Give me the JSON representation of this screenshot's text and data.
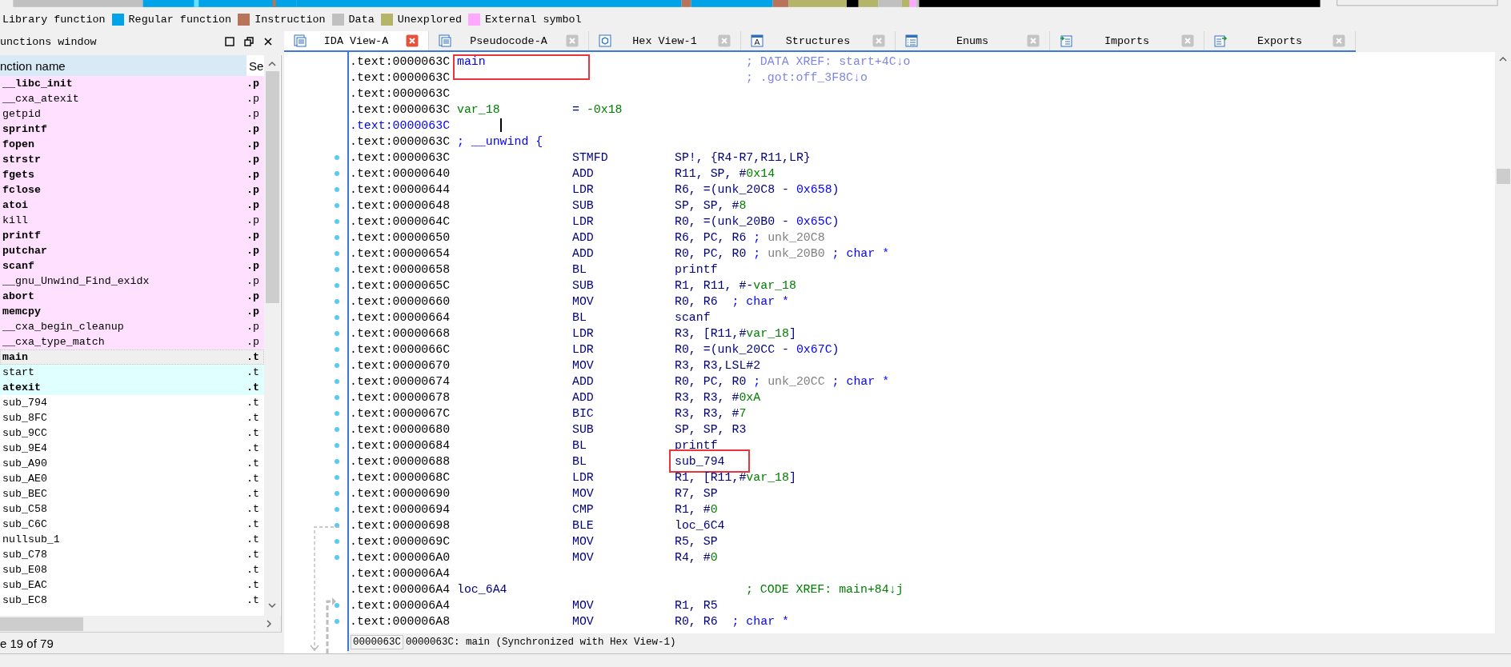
{
  "legend": [
    {
      "label": "Library function"
    },
    {
      "label": "Regular function",
      "color": "#00a2e8"
    },
    {
      "label": "Instruction",
      "color": "#b8735a"
    },
    {
      "label": "Data",
      "color": "#c0c0c0"
    },
    {
      "label": "Unexplored",
      "color": "#b5b56a"
    },
    {
      "label": "External symbol",
      "color": "#ffa8ff"
    }
  ],
  "functions_window": {
    "title": "unctions window",
    "columns": [
      "nction name",
      "Se"
    ],
    "rows": [
      {
        "name": "__libc_init",
        "column_2": ".p",
        "bold": true,
        "color": "#ffe1ff",
        "selected": false
      },
      {
        "name": "__cxa_atexit",
        "column_2": ".p",
        "bold": false,
        "color": "#ffe1ff",
        "selected": false
      },
      {
        "name": "getpid",
        "column_2": ".p",
        "bold": false,
        "color": "#ffe1ff",
        "selected": false
      },
      {
        "name": "sprintf",
        "column_2": ".p",
        "bold": true,
        "color": "#ffe1ff",
        "selected": false
      },
      {
        "name": "fopen",
        "column_2": ".p",
        "bold": true,
        "color": "#ffe1ff",
        "selected": false
      },
      {
        "name": "strstr",
        "column_2": ".p",
        "bold": true,
        "color": "#ffe1ff",
        "selected": false
      },
      {
        "name": "fgets",
        "column_2": ".p",
        "bold": true,
        "color": "#ffe1ff",
        "selected": false
      },
      {
        "name": "fclose",
        "column_2": ".p",
        "bold": true,
        "color": "#ffe1ff",
        "selected": false
      },
      {
        "name": "atoi",
        "column_2": ".p",
        "bold": true,
        "color": "#ffe1ff",
        "selected": false
      },
      {
        "name": "kill",
        "column_2": ".p",
        "bold": false,
        "color": "#ffe1ff",
        "selected": false
      },
      {
        "name": "printf",
        "column_2": ".p",
        "bold": true,
        "color": "#ffe1ff",
        "selected": false
      },
      {
        "name": "putchar",
        "column_2": ".p",
        "bold": true,
        "color": "#ffe1ff",
        "selected": false
      },
      {
        "name": "scanf",
        "column_2": ".p",
        "bold": true,
        "color": "#ffe1ff",
        "selected": false
      },
      {
        "name": "__gnu_Unwind_Find_exidx",
        "column_2": ".p",
        "bold": false,
        "color": "#ffe1ff",
        "selected": false
      },
      {
        "name": "abort",
        "column_2": ".p",
        "bold": true,
        "color": "#ffe1ff",
        "selected": false
      },
      {
        "name": "memcpy",
        "column_2": ".p",
        "bold": true,
        "color": "#ffe1ff",
        "selected": false
      },
      {
        "name": "__cxa_begin_cleanup",
        "column_2": ".p",
        "bold": false,
        "color": "#ffe1ff",
        "selected": false
      },
      {
        "name": "__cxa_type_match",
        "column_2": ".p",
        "bold": false,
        "color": "#ffe1ff",
        "selected": false
      },
      {
        "name": "main",
        "column_2": ".t",
        "bold": true,
        "color": "#efefef",
        "selected": true
      },
      {
        "name": "start",
        "column_2": ".t",
        "bold": false,
        "color": "#e0ffff",
        "selected": false
      },
      {
        "name": "atexit",
        "column_2": ".t",
        "bold": true,
        "color": "#e0ffff",
        "selected": false
      },
      {
        "name": "sub_794",
        "column_2": ".t",
        "bold": false,
        "color": "#ffffff",
        "selected": false
      },
      {
        "name": "sub_8FC",
        "column_2": ".t",
        "bold": false,
        "color": "#ffffff",
        "selected": false
      },
      {
        "name": "sub_9CC",
        "column_2": ".t",
        "bold": false,
        "color": "#ffffff",
        "selected": false
      },
      {
        "name": "sub_9E4",
        "column_2": ".t",
        "bold": false,
        "color": "#ffffff",
        "selected": false
      },
      {
        "name": "sub_A90",
        "column_2": ".t",
        "bold": false,
        "color": "#ffffff",
        "selected": false
      },
      {
        "name": "sub_AE0",
        "column_2": ".t",
        "bold": false,
        "color": "#ffffff",
        "selected": false
      },
      {
        "name": "sub_BEC",
        "column_2": ".t",
        "bold": false,
        "color": "#ffffff",
        "selected": false
      },
      {
        "name": "sub_C58",
        "column_2": ".t",
        "bold": false,
        "color": "#ffffff",
        "selected": false
      },
      {
        "name": "sub_C6C",
        "column_2": ".t",
        "bold": false,
        "color": "#ffffff",
        "selected": false
      },
      {
        "name": "nullsub_1",
        "column_2": ".t",
        "bold": false,
        "color": "#ffffff",
        "selected": false
      },
      {
        "name": "sub_C78",
        "column_2": ".t",
        "bold": false,
        "color": "#ffffff",
        "selected": false
      },
      {
        "name": "sub_E08",
        "column_2": ".t",
        "bold": false,
        "color": "#ffffff",
        "selected": false
      },
      {
        "name": "sub_EAC",
        "column_2": ".t",
        "bold": false,
        "color": "#ffffff",
        "selected": false
      },
      {
        "name": "sub_EC8",
        "column_2": ".t",
        "bold": false,
        "color": "#ffffff",
        "selected": false
      }
    ],
    "status": "e 19 of 79"
  },
  "tabs": [
    {
      "label": "IDA View-A",
      "kind": "disasm",
      "selected": true
    },
    {
      "label": "Pseudocode-A",
      "kind": "pseudocode",
      "selected": false
    },
    {
      "label": "Hex View-1",
      "kind": "hex",
      "selected": false
    },
    {
      "label": "Structures",
      "kind": "structures",
      "selected": false
    },
    {
      "label": "Enums",
      "kind": "enums",
      "selected": false
    },
    {
      "label": "Imports",
      "kind": "imports",
      "selected": false
    },
    {
      "label": "Exports",
      "kind": "exports",
      "selected": false
    }
  ],
  "disassembly": {
    "lines": [
      {
        "address": ".text:0000063C",
        "selected": false,
        "dot": false,
        "label": [
          {
            "text": "main",
            "kind": "name",
            "boxed": true
          }
        ],
        "comment": [
          {
            "text": "; DATA XREF: start+4C↓o",
            "kind": "xref"
          }
        ]
      },
      {
        "address": ".text:0000063C",
        "selected": false,
        "dot": false,
        "comment": [
          {
            "text": "; .got:off_3F8C↓o",
            "kind": "xref"
          }
        ]
      },
      {
        "address": ".text:0000063C",
        "selected": false,
        "dot": false
      },
      {
        "address": ".text:0000063C",
        "selected": false,
        "dot": false,
        "label": [
          {
            "text": "var_18",
            "kind": "var"
          }
        ],
        "mnemonic": [
          {
            "text": "= ",
            "kind": "code"
          },
          {
            "text": "-0x18",
            "kind": "num"
          }
        ]
      },
      {
        "address": ".text:0000063C",
        "selected": true,
        "dot": false
      },
      {
        "address": ".text:0000063C",
        "selected": false,
        "dot": false,
        "label": [
          {
            "text": "; __unwind {",
            "kind": "cmt"
          }
        ]
      },
      {
        "address": ".text:0000063C",
        "selected": false,
        "dot": true,
        "mnemonic": [
          {
            "text": "STMFD",
            "kind": "code"
          }
        ],
        "operands": [
          {
            "text": "SP!, {R4-R7,R11,LR}",
            "kind": "code"
          }
        ]
      },
      {
        "address": ".text:00000640",
        "selected": false,
        "dot": true,
        "mnemonic": [
          {
            "text": "ADD",
            "kind": "code"
          }
        ],
        "operands": [
          {
            "text": "R11, SP, #",
            "kind": "code"
          },
          {
            "text": "0x14",
            "kind": "num"
          }
        ]
      },
      {
        "address": ".text:00000644",
        "selected": false,
        "dot": true,
        "mnemonic": [
          {
            "text": "LDR",
            "kind": "code"
          }
        ],
        "operands": [
          {
            "text": "R6, =(unk_20C8 - ",
            "kind": "code"
          },
          {
            "text": "0x658",
            "kind": "addr"
          },
          {
            "text": ")",
            "kind": "code"
          }
        ]
      },
      {
        "address": ".text:00000648",
        "selected": false,
        "dot": true,
        "mnemonic": [
          {
            "text": "SUB",
            "kind": "code"
          }
        ],
        "operands": [
          {
            "text": "SP, SP, #",
            "kind": "code"
          },
          {
            "text": "8",
            "kind": "num"
          }
        ]
      },
      {
        "address": ".text:0000064C",
        "selected": false,
        "dot": true,
        "mnemonic": [
          {
            "text": "LDR",
            "kind": "code"
          }
        ],
        "operands": [
          {
            "text": "R0, =(unk_20B0 - ",
            "kind": "code"
          },
          {
            "text": "0x65C",
            "kind": "addr"
          },
          {
            "text": ")",
            "kind": "code"
          }
        ]
      },
      {
        "address": ".text:00000650",
        "selected": false,
        "dot": true,
        "mnemonic": [
          {
            "text": "ADD",
            "kind": "code"
          }
        ],
        "operands": [
          {
            "text": "R6, PC, R6 ",
            "kind": "code"
          },
          {
            "text": "; ",
            "kind": "cmt"
          },
          {
            "text": "unk_20C8",
            "kind": "auto"
          }
        ]
      },
      {
        "address": ".text:00000654",
        "selected": false,
        "dot": true,
        "mnemonic": [
          {
            "text": "ADD",
            "kind": "code"
          }
        ],
        "operands": [
          {
            "text": "R0, PC, R0 ",
            "kind": "code"
          },
          {
            "text": "; ",
            "kind": "cmt"
          },
          {
            "text": "unk_20B0",
            "kind": "auto"
          },
          {
            "text": " ; char *",
            "kind": "cmt"
          }
        ]
      },
      {
        "address": ".text:00000658",
        "selected": false,
        "dot": true,
        "mnemonic": [
          {
            "text": "BL",
            "kind": "code"
          }
        ],
        "operands": [
          {
            "text": "printf",
            "kind": "code"
          }
        ]
      },
      {
        "address": ".text:0000065C",
        "selected": false,
        "dot": true,
        "mnemonic": [
          {
            "text": "SUB",
            "kind": "code"
          }
        ],
        "operands": [
          {
            "text": "R1, R11, #-",
            "kind": "code"
          },
          {
            "text": "var_18",
            "kind": "var"
          }
        ]
      },
      {
        "address": ".text:00000660",
        "selected": false,
        "dot": true,
        "mnemonic": [
          {
            "text": "MOV",
            "kind": "code"
          }
        ],
        "operands": [
          {
            "text": "R0, R6  ",
            "kind": "code"
          },
          {
            "text": "; char *",
            "kind": "cmt"
          }
        ]
      },
      {
        "address": ".text:00000664",
        "selected": false,
        "dot": true,
        "mnemonic": [
          {
            "text": "BL",
            "kind": "code"
          }
        ],
        "operands": [
          {
            "text": "scanf",
            "kind": "code"
          }
        ]
      },
      {
        "address": ".text:00000668",
        "selected": false,
        "dot": true,
        "mnemonic": [
          {
            "text": "LDR",
            "kind": "code"
          }
        ],
        "operands": [
          {
            "text": "R3, [R11,#",
            "kind": "code"
          },
          {
            "text": "var_18",
            "kind": "var"
          },
          {
            "text": "]",
            "kind": "code"
          }
        ]
      },
      {
        "address": ".text:0000066C",
        "selected": false,
        "dot": true,
        "mnemonic": [
          {
            "text": "LDR",
            "kind": "code"
          }
        ],
        "operands": [
          {
            "text": "R0, =(unk_20CC - ",
            "kind": "code"
          },
          {
            "text": "0x67C",
            "kind": "addr"
          },
          {
            "text": ")",
            "kind": "code"
          }
        ]
      },
      {
        "address": ".text:00000670",
        "selected": false,
        "dot": true,
        "mnemonic": [
          {
            "text": "MOV",
            "kind": "code"
          }
        ],
        "operands": [
          {
            "text": "R3, R3,LSL#2",
            "kind": "code"
          }
        ]
      },
      {
        "address": ".text:00000674",
        "selected": false,
        "dot": true,
        "mnemonic": [
          {
            "text": "ADD",
            "kind": "code"
          }
        ],
        "operands": [
          {
            "text": "R0, PC, R0 ",
            "kind": "code"
          },
          {
            "text": "; ",
            "kind": "cmt"
          },
          {
            "text": "unk_20CC",
            "kind": "auto"
          },
          {
            "text": " ; char *",
            "kind": "cmt"
          }
        ]
      },
      {
        "address": ".text:00000678",
        "selected": false,
        "dot": true,
        "mnemonic": [
          {
            "text": "ADD",
            "kind": "code"
          }
        ],
        "operands": [
          {
            "text": "R3, R3, #",
            "kind": "code"
          },
          {
            "text": "0xA",
            "kind": "num"
          }
        ]
      },
      {
        "address": ".text:0000067C",
        "selected": false,
        "dot": true,
        "mnemonic": [
          {
            "text": "BIC",
            "kind": "code"
          }
        ],
        "operands": [
          {
            "text": "R3, R3, #",
            "kind": "code"
          },
          {
            "text": "7",
            "kind": "num"
          }
        ]
      },
      {
        "address": ".text:00000680",
        "selected": false,
        "dot": true,
        "mnemonic": [
          {
            "text": "SUB",
            "kind": "code"
          }
        ],
        "operands": [
          {
            "text": "SP, SP, R3",
            "kind": "code"
          }
        ]
      },
      {
        "address": ".text:00000684",
        "selected": false,
        "dot": true,
        "mnemonic": [
          {
            "text": "BL",
            "kind": "code"
          }
        ],
        "operands": [
          {
            "text": "printf",
            "kind": "code"
          }
        ]
      },
      {
        "address": ".text:00000688",
        "selected": false,
        "dot": true,
        "mnemonic": [
          {
            "text": "BL",
            "kind": "code"
          }
        ],
        "operands": [
          {
            "text": "sub_794",
            "kind": "code",
            "boxed": true
          }
        ]
      },
      {
        "address": ".text:0000068C",
        "selected": false,
        "dot": true,
        "mnemonic": [
          {
            "text": "LDR",
            "kind": "code"
          }
        ],
        "operands": [
          {
            "text": "R1, [R11,#",
            "kind": "code"
          },
          {
            "text": "var_18",
            "kind": "var"
          },
          {
            "text": "]",
            "kind": "code"
          }
        ]
      },
      {
        "address": ".text:00000690",
        "selected": false,
        "dot": true,
        "mnemonic": [
          {
            "text": "MOV",
            "kind": "code"
          }
        ],
        "operands": [
          {
            "text": "R7, SP",
            "kind": "code"
          }
        ]
      },
      {
        "address": ".text:00000694",
        "selected": false,
        "dot": true,
        "mnemonic": [
          {
            "text": "CMP",
            "kind": "code"
          }
        ],
        "operands": [
          {
            "text": "R1, #",
            "kind": "code"
          },
          {
            "text": "0",
            "kind": "num"
          }
        ]
      },
      {
        "address": ".text:00000698",
        "selected": false,
        "dot": true,
        "mnemonic": [
          {
            "text": "BLE",
            "kind": "code"
          }
        ],
        "operands": [
          {
            "text": "loc_6C4",
            "kind": "code"
          }
        ]
      },
      {
        "address": ".text:0000069C",
        "selected": false,
        "dot": true,
        "mnemonic": [
          {
            "text": "MOV",
            "kind": "code"
          }
        ],
        "operands": [
          {
            "text": "R5, SP",
            "kind": "code"
          }
        ]
      },
      {
        "address": ".text:000006A0",
        "selected": false,
        "dot": true,
        "mnemonic": [
          {
            "text": "MOV",
            "kind": "code"
          }
        ],
        "operands": [
          {
            "text": "R4, #",
            "kind": "code"
          },
          {
            "text": "0",
            "kind": "num"
          }
        ]
      },
      {
        "address": ".text:000006A4",
        "selected": false,
        "dot": false
      },
      {
        "address": ".text:000006A4",
        "selected": false,
        "dot": false,
        "label": [
          {
            "text": "loc_6A4",
            "kind": "code"
          }
        ],
        "comment": [
          {
            "text": "; CODE XREF: main+84↓j",
            "kind": "cxref"
          }
        ]
      },
      {
        "address": ".text:000006A4",
        "selected": false,
        "dot": true,
        "mnemonic": [
          {
            "text": "MOV",
            "kind": "code"
          }
        ],
        "operands": [
          {
            "text": "R1, R5",
            "kind": "code"
          }
        ]
      },
      {
        "address": ".text:000006A8",
        "selected": false,
        "dot": true,
        "mnemonic": [
          {
            "text": "MOV",
            "kind": "code"
          }
        ],
        "operands": [
          {
            "text": "R0, R6  ",
            "kind": "code"
          },
          {
            "text": "; char *",
            "kind": "cmt"
          }
        ]
      }
    ],
    "status": [
      "0000063C",
      "0000063C: main (Synchronized with Hex View-1)"
    ]
  }
}
